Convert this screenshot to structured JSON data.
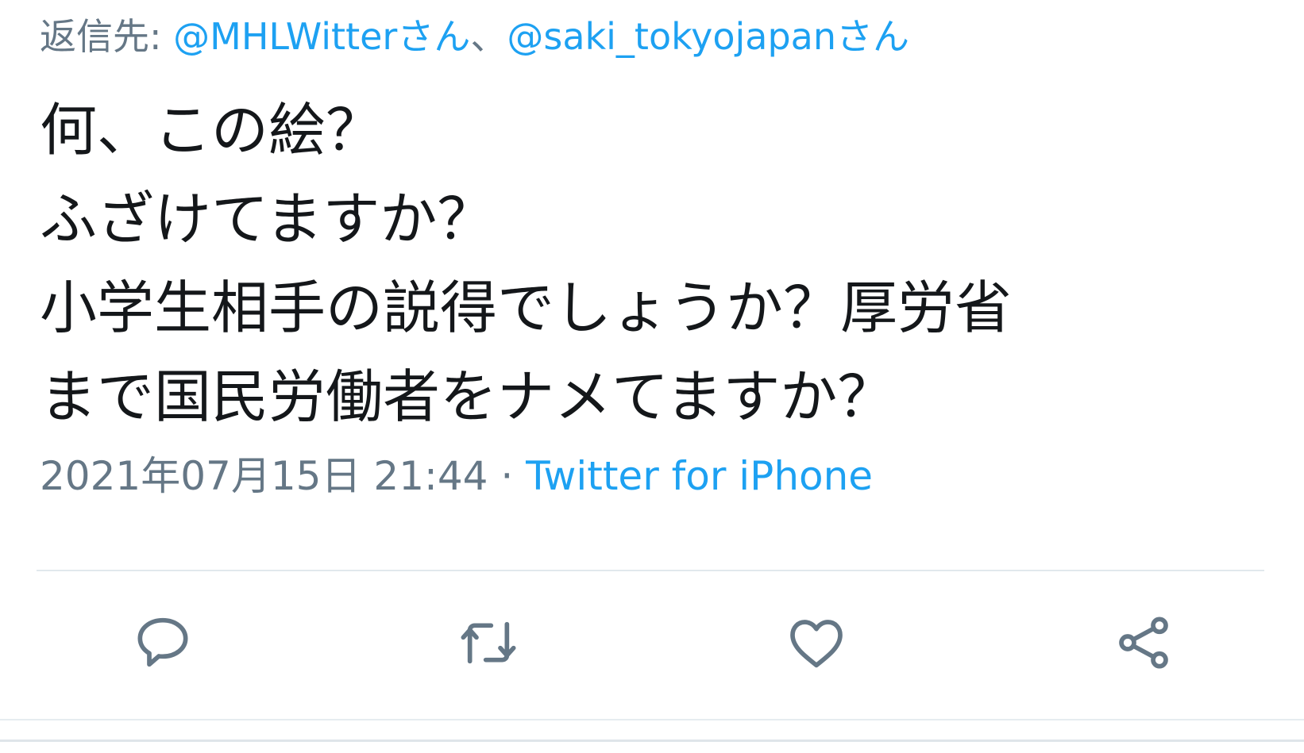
{
  "reply_to": {
    "prefix": "返信先: ",
    "handles": [
      {
        "text": "@MHLWitterさん"
      },
      {
        "text": "@saki_tokyojapanさん"
      }
    ],
    "separator": "、"
  },
  "tweet": {
    "lines": [
      "何、この絵？",
      "ふざけてますか？",
      "小学生相手の説得でしょうか？厚労省",
      "まで国民労働者をナメてますか？"
    ],
    "timestamp": "2021年07月15日 21:44",
    "separator": " · ",
    "source": "Twitter for iPhone"
  },
  "actions": [
    {
      "icon": "reply-icon"
    },
    {
      "icon": "retweet-icon"
    },
    {
      "icon": "like-icon"
    },
    {
      "icon": "share-icon"
    }
  ],
  "colors": {
    "text": "#14171a",
    "secondary": "#657786",
    "link": "#1da1f2",
    "divider": "#e1e8ed",
    "background": "#ffffff"
  }
}
